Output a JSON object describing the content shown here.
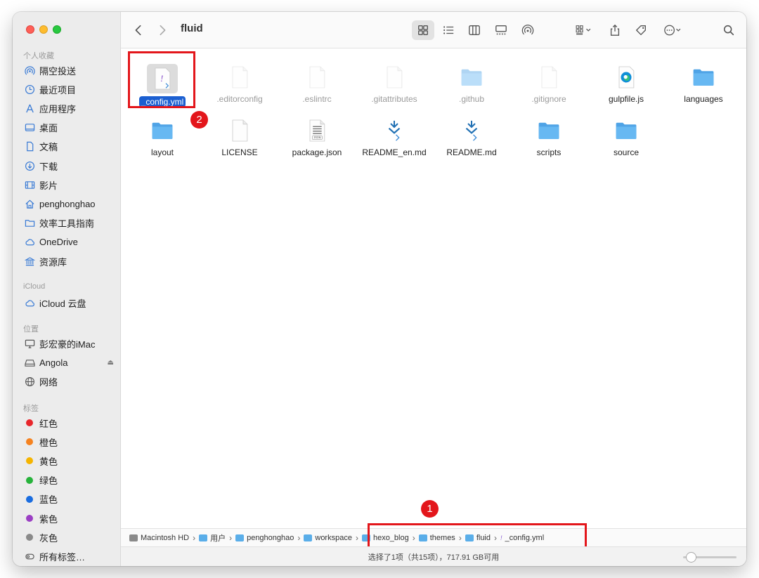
{
  "window": {
    "title": "fluid"
  },
  "sidebar": {
    "sections": {
      "favorites": "个人收藏",
      "icloud": "iCloud",
      "locations": "位置",
      "tags": "标签"
    },
    "favorites": [
      {
        "label": "隔空投送",
        "icon": "airdrop-icon"
      },
      {
        "label": "最近项目",
        "icon": "clock-icon"
      },
      {
        "label": "应用程序",
        "icon": "applications-icon"
      },
      {
        "label": "桌面",
        "icon": "desktop-icon"
      },
      {
        "label": "文稿",
        "icon": "document-icon"
      },
      {
        "label": "下载",
        "icon": "download-icon"
      },
      {
        "label": "影片",
        "icon": "movies-icon"
      },
      {
        "label": "penghonghao",
        "icon": "home-icon"
      },
      {
        "label": "效率工具指南",
        "icon": "folder-icon"
      },
      {
        "label": "OneDrive",
        "icon": "cloud-icon"
      },
      {
        "label": "资源库",
        "icon": "library-icon"
      }
    ],
    "icloud": [
      {
        "label": "iCloud 云盘",
        "icon": "cloud-icon"
      }
    ],
    "locations": [
      {
        "label": "彭宏豪的iMac",
        "icon": "computer-icon"
      },
      {
        "label": "Angola",
        "icon": "drive-icon",
        "eject": "⏏"
      },
      {
        "label": "网络",
        "icon": "network-icon"
      }
    ],
    "tags": [
      {
        "label": "红色",
        "color": "#e8262b"
      },
      {
        "label": "橙色",
        "color": "#f5821f"
      },
      {
        "label": "黄色",
        "color": "#f5b400"
      },
      {
        "label": "绿色",
        "color": "#27b33b"
      },
      {
        "label": "蓝色",
        "color": "#1a6de0"
      },
      {
        "label": "紫色",
        "color": "#9b3fc4"
      },
      {
        "label": "灰色",
        "color": "#8a8a8a"
      },
      {
        "label": "所有标签…",
        "color": ""
      }
    ]
  },
  "files": [
    {
      "name": "_config.yml",
      "kind": "yml",
      "selected": true,
      "hidden": false
    },
    {
      "name": ".editorconfig",
      "kind": "doc",
      "selected": false,
      "hidden": true
    },
    {
      "name": ".eslintrc",
      "kind": "doc",
      "selected": false,
      "hidden": true
    },
    {
      "name": ".gitattributes",
      "kind": "doc",
      "selected": false,
      "hidden": true
    },
    {
      "name": ".github",
      "kind": "folder",
      "selected": false,
      "hidden": true
    },
    {
      "name": ".gitignore",
      "kind": "doc",
      "selected": false,
      "hidden": true
    },
    {
      "name": "gulpfile.js",
      "kind": "edge",
      "selected": false,
      "hidden": false
    },
    {
      "name": "languages",
      "kind": "folder",
      "selected": false,
      "hidden": false
    },
    {
      "name": "layout",
      "kind": "folder",
      "selected": false,
      "hidden": false
    },
    {
      "name": "LICENSE",
      "kind": "doc",
      "selected": false,
      "hidden": false
    },
    {
      "name": "package.json",
      "kind": "json",
      "selected": false,
      "hidden": false
    },
    {
      "name": "README_en.md",
      "kind": "md",
      "selected": false,
      "hidden": false
    },
    {
      "name": "README.md",
      "kind": "md",
      "selected": false,
      "hidden": false
    },
    {
      "name": "scripts",
      "kind": "folder",
      "selected": false,
      "hidden": false
    },
    {
      "name": "source",
      "kind": "folder",
      "selected": false,
      "hidden": false
    }
  ],
  "json_icon_text": "JSON",
  "yml_icon_glyph": "!",
  "pathbar": [
    {
      "label": "Macintosh HD",
      "icon": "hd"
    },
    {
      "label": "用户",
      "icon": "folder"
    },
    {
      "label": "penghonghao",
      "icon": "folder"
    },
    {
      "label": "workspace",
      "icon": "folder"
    },
    {
      "label": "hexo_blog",
      "icon": "folder"
    },
    {
      "label": "themes",
      "icon": "folder"
    },
    {
      "label": "fluid",
      "icon": "folder"
    },
    {
      "label": "_config.yml",
      "icon": "yml"
    }
  ],
  "pathbar_separator": "›",
  "status": {
    "text": "选择了1项（共15项），717.91 GB可用"
  },
  "annotations": {
    "badge1": "1",
    "badge2": "2"
  },
  "colors": {
    "accent": "#1b5fd1",
    "annotation": "#e3161b",
    "folder": "#5aaee9"
  }
}
